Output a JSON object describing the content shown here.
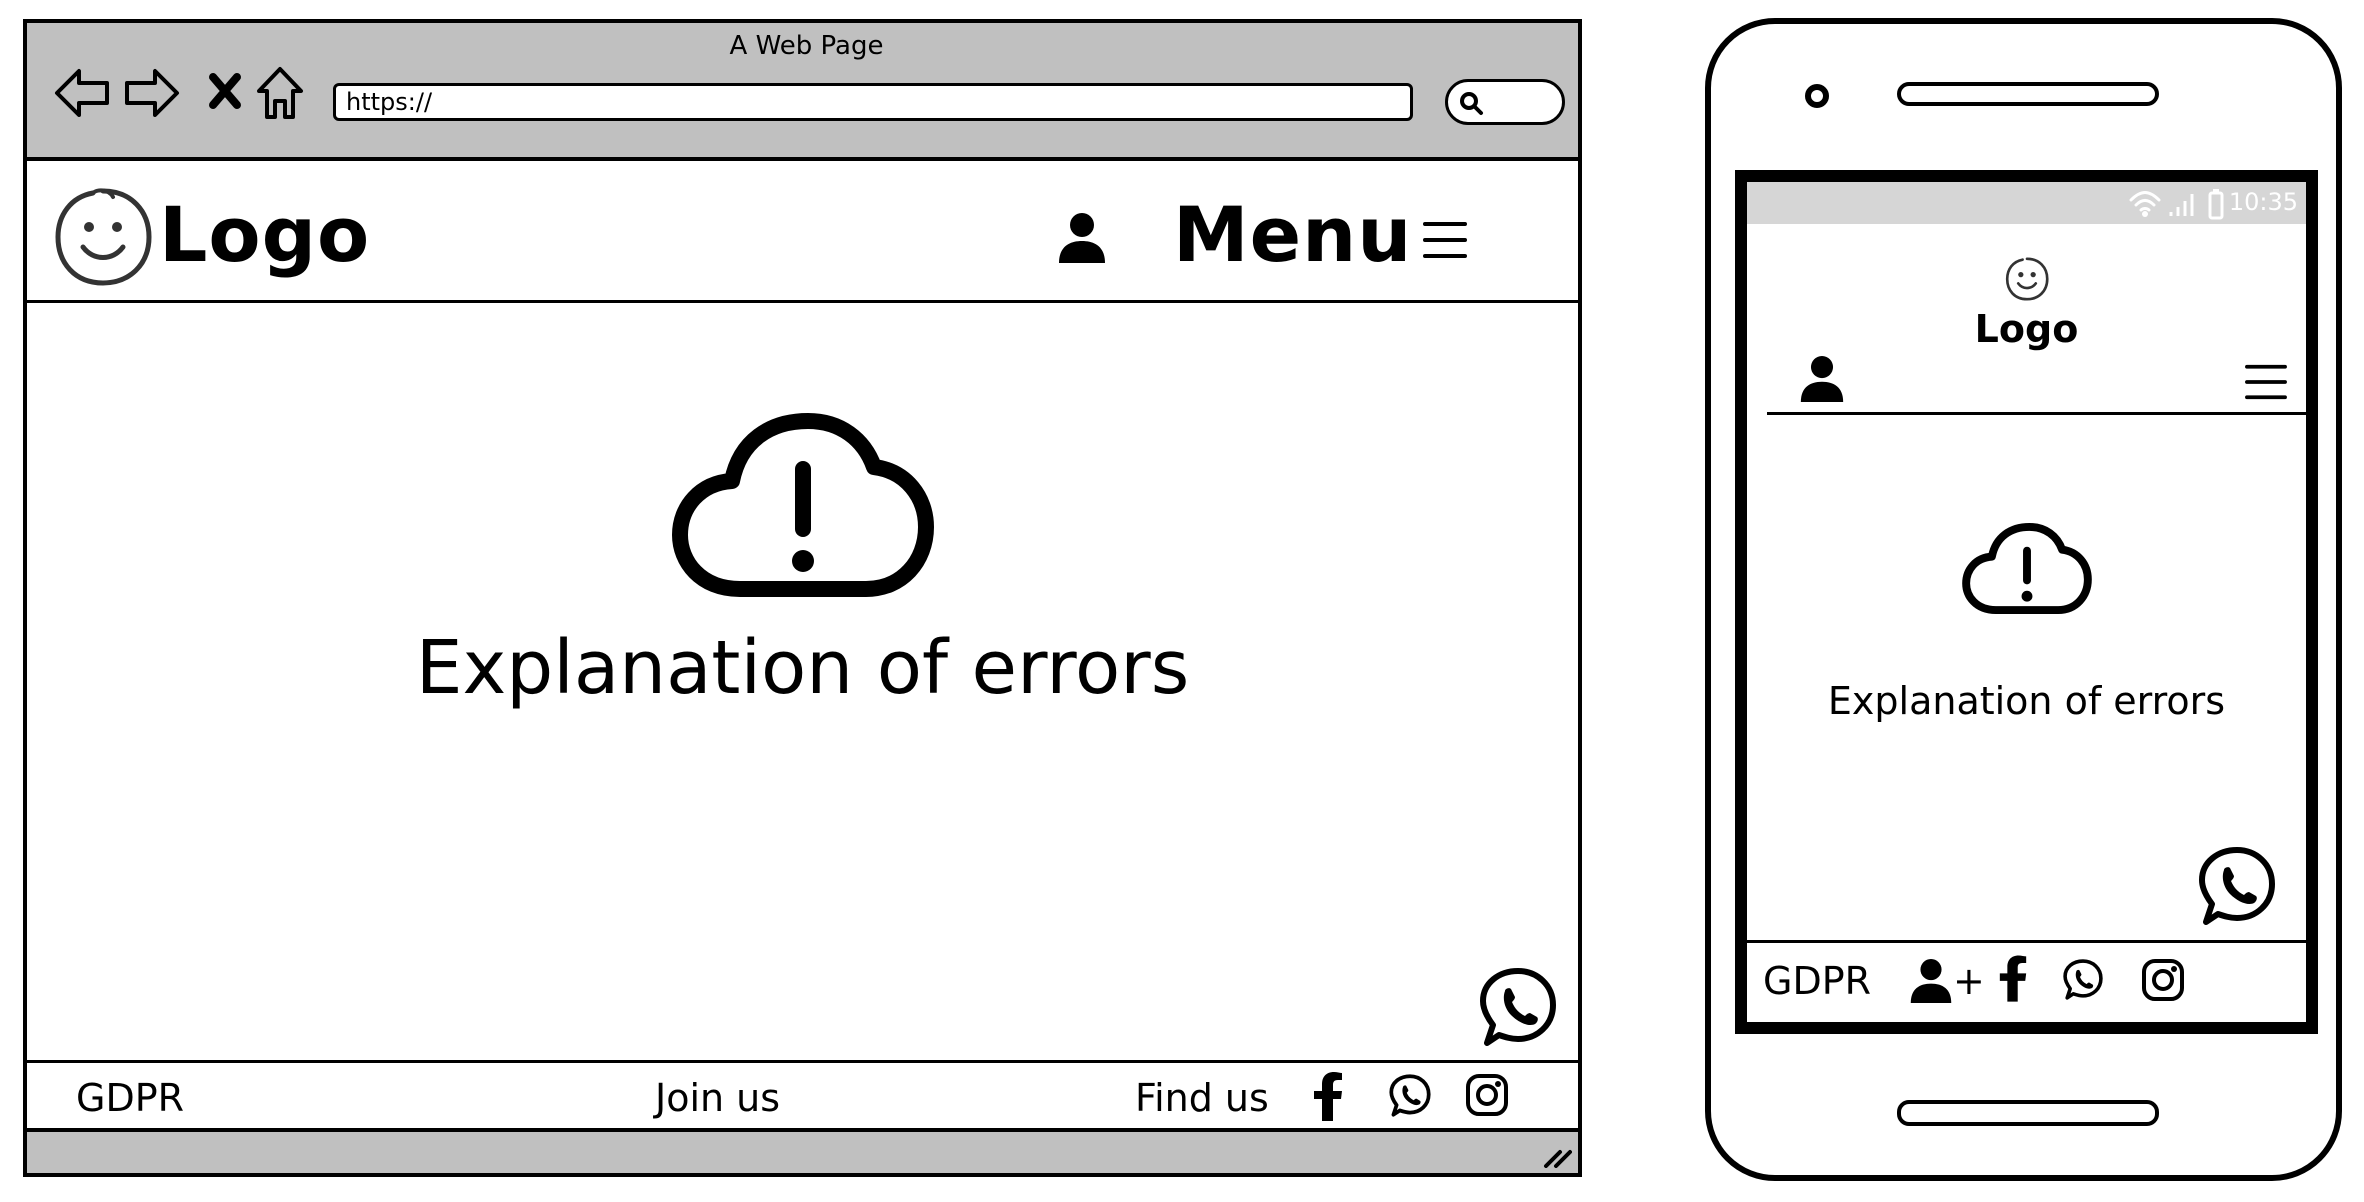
{
  "browser": {
    "window_title": "A Web Page",
    "url": "https://",
    "icons": [
      "back-arrow-icon",
      "forward-arrow-icon",
      "close-x-icon",
      "home-icon",
      "search-icon"
    ]
  },
  "site": {
    "logo_text": "Logo",
    "menu_text": "Menu",
    "error_message": "Explanation of errors",
    "footer": {
      "gdpr": "GDPR",
      "join_us": "Join us",
      "find_us": "Find us"
    }
  },
  "phone": {
    "status_time": "10:35",
    "logo_text": "Logo",
    "error_message": "Explanation of errors",
    "footer_gdpr": "GDPR",
    "add_user_plus": "+"
  },
  "colors": {
    "chrome_gray": "#c0c0c0",
    "status_bar_gray": "#d6d6d6",
    "ink": "#000000"
  }
}
